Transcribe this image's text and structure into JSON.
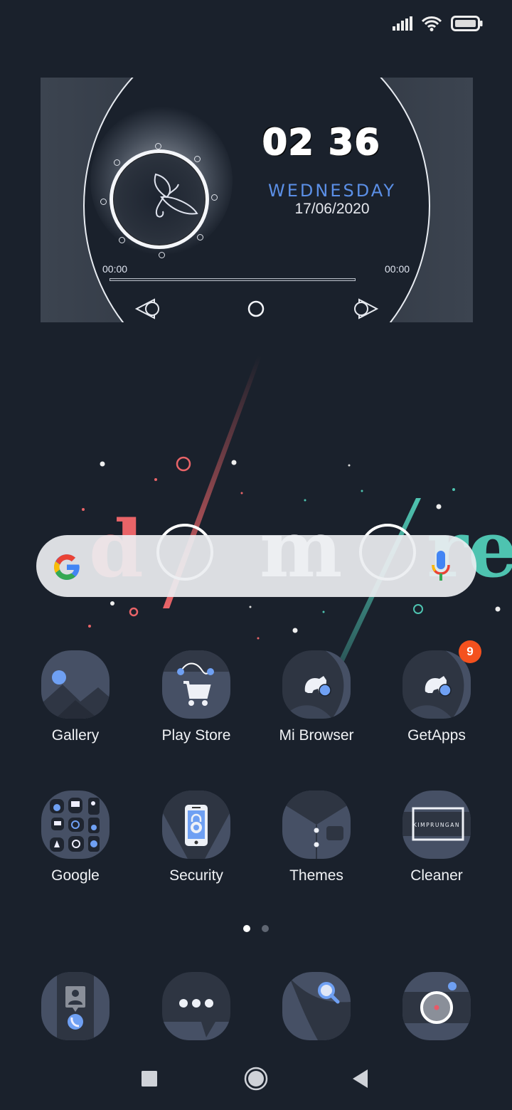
{
  "status_bar": {
    "icons": [
      "signal-icon",
      "wifi-icon",
      "battery-icon"
    ]
  },
  "music_widget": {
    "time": "02 36",
    "weekday": "WEDNESDAY",
    "date": "17/06/2020",
    "elapsed": "00:00",
    "duration": "00:00",
    "progress": 0,
    "controls": [
      "previous-icon",
      "play-icon",
      "next-icon"
    ],
    "art_icon": "butterfly-icon"
  },
  "wallpaper": {
    "text": "do more",
    "colors": {
      "red": "#e96468",
      "white": "#ffffff",
      "teal": "#4ec3b0"
    }
  },
  "search_bar": {
    "logo": "google-g-icon",
    "voice": "microphone-icon"
  },
  "apps": [
    {
      "label": "Gallery",
      "icon": "gallery-icon"
    },
    {
      "label": "Play Store",
      "icon": "play-store-icon"
    },
    {
      "label": "Mi Browser",
      "icon": "mi-browser-icon"
    },
    {
      "label": "GetApps",
      "icon": "getapps-icon",
      "badge": "9"
    },
    {
      "label": "Google",
      "icon": "google-folder-icon"
    },
    {
      "label": "Security",
      "icon": "security-icon"
    },
    {
      "label": "Themes",
      "icon": "themes-icon"
    },
    {
      "label": "Cleaner",
      "icon": "cleaner-icon",
      "icon_text": "KIMPRUNGAN"
    }
  ],
  "page_indicator": {
    "pages": 2,
    "current": 1
  },
  "dock": [
    {
      "icon": "phone-icon"
    },
    {
      "icon": "messages-icon"
    },
    {
      "icon": "browser-search-icon"
    },
    {
      "icon": "camera-icon"
    }
  ],
  "nav_bar": {
    "buttons": [
      "recents-button",
      "home-button",
      "back-button"
    ]
  },
  "colors": {
    "background": "#1a212c",
    "icon_bg": "#465065",
    "accent_blue": "#5b8fe6",
    "badge": "#f4511e"
  }
}
